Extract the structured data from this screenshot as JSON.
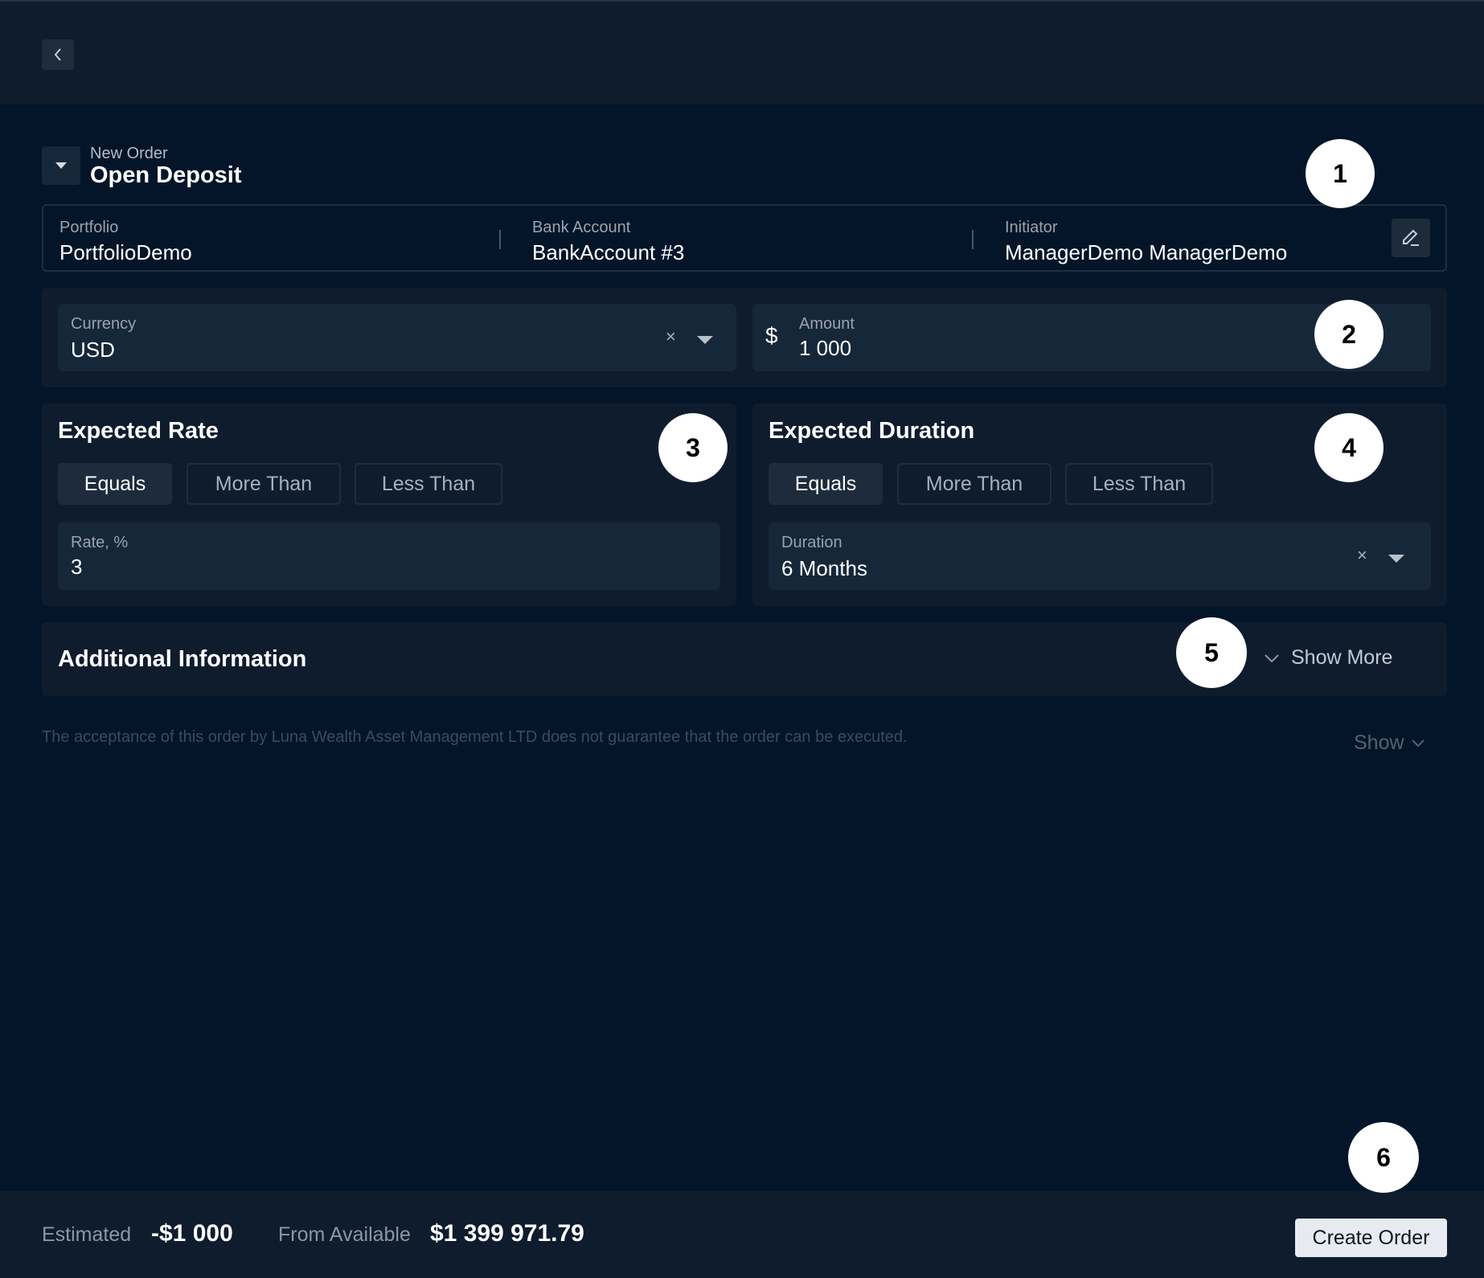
{
  "header": {
    "subtitle": "New Order",
    "title": "Open Deposit"
  },
  "info": {
    "portfolio": {
      "label": "Portfolio",
      "value": "PortfolioDemo"
    },
    "bank_account": {
      "label": "Bank Account",
      "value": "BankAccount #3"
    },
    "initiator": {
      "label": "Initiator",
      "value": "ManagerDemo ManagerDemo"
    }
  },
  "currency": {
    "label": "Currency",
    "value": "USD",
    "clear": "×"
  },
  "amount": {
    "label": "Amount",
    "symbol": "$",
    "value": "1 000"
  },
  "expected_rate": {
    "title": "Expected Rate",
    "options": [
      "Equals",
      "More Than",
      "Less Than"
    ],
    "selected": "Equals",
    "field": {
      "label": "Rate, %",
      "value": "3"
    }
  },
  "expected_duration": {
    "title": "Expected Duration",
    "options": [
      "Equals",
      "More Than",
      "Less Than"
    ],
    "selected": "Equals",
    "field": {
      "label": "Duration",
      "value": "6 Months",
      "clear": "×"
    }
  },
  "additional": {
    "title": "Additional Information",
    "toggle_label": "Show More"
  },
  "disclaimer": {
    "text": "The acceptance of this order by Luna Wealth Asset Management LTD does not guarantee that the order can be executed.",
    "show_label": "Show"
  },
  "footer": {
    "estimated_label": "Estimated",
    "estimated_value": "-$1 000",
    "available_label": "From Available",
    "available_value": "$1 399 971.79",
    "create_label": "Create Order"
  },
  "badges": [
    "1",
    "2",
    "3",
    "4",
    "5",
    "6"
  ],
  "icons": {
    "back": "chevron-left-icon",
    "collapse": "caret-down-icon",
    "edit": "pencil-icon",
    "dropdown": "caret-down-icon",
    "expand": "chevron-down-icon"
  },
  "colors": {
    "background": "#04152a",
    "panel": "#0e1c2e",
    "field": "#17273a",
    "button_primary": "#e7ebf1"
  }
}
